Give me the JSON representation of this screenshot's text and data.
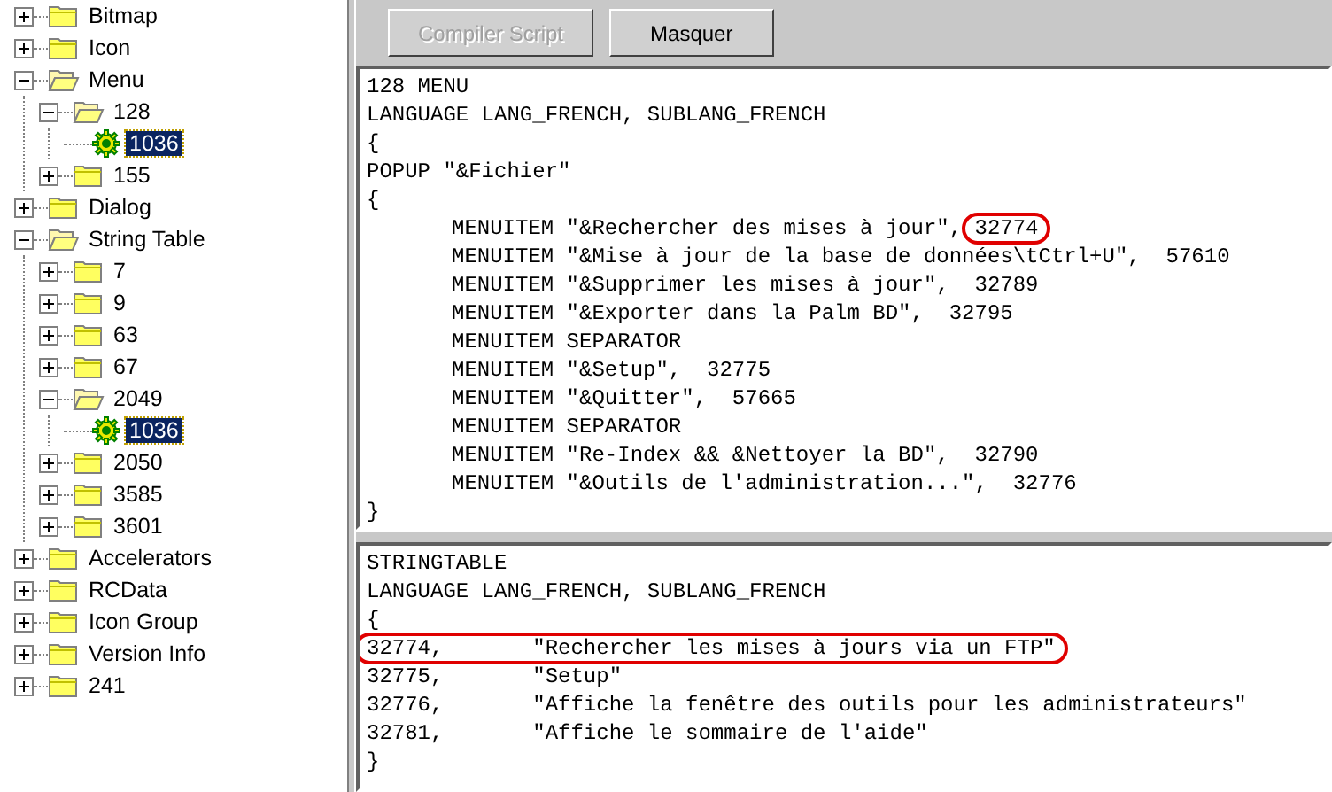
{
  "tree": [
    {
      "label": "Bitmap",
      "kind": "folder",
      "expanded": false,
      "selected": false
    },
    {
      "label": "Icon",
      "kind": "folder",
      "expanded": false,
      "selected": false
    },
    {
      "label": "Menu",
      "kind": "folder",
      "expanded": true,
      "selected": false,
      "children": [
        {
          "label": "128",
          "kind": "folder",
          "expanded": true,
          "selected": false,
          "children": [
            {
              "label": "1036",
              "kind": "resource",
              "selected": true
            }
          ]
        },
        {
          "label": "155",
          "kind": "folder",
          "expanded": false,
          "selected": false
        }
      ]
    },
    {
      "label": "Dialog",
      "kind": "folder",
      "expanded": false,
      "selected": false
    },
    {
      "label": "String Table",
      "kind": "folder",
      "expanded": true,
      "selected": false,
      "children": [
        {
          "label": "7",
          "kind": "folder",
          "expanded": false,
          "selected": false
        },
        {
          "label": "9",
          "kind": "folder",
          "expanded": false,
          "selected": false
        },
        {
          "label": "63",
          "kind": "folder",
          "expanded": false,
          "selected": false
        },
        {
          "label": "67",
          "kind": "folder",
          "expanded": false,
          "selected": false
        },
        {
          "label": "2049",
          "kind": "folder",
          "expanded": true,
          "selected": false,
          "children": [
            {
              "label": "1036",
              "kind": "resource",
              "selected": true
            }
          ]
        },
        {
          "label": "2050",
          "kind": "folder",
          "expanded": false,
          "selected": false
        },
        {
          "label": "3585",
          "kind": "folder",
          "expanded": false,
          "selected": false
        },
        {
          "label": "3601",
          "kind": "folder",
          "expanded": false,
          "selected": false
        }
      ]
    },
    {
      "label": "Accelerators",
      "kind": "folder",
      "expanded": false,
      "selected": false
    },
    {
      "label": "RCData",
      "kind": "folder",
      "expanded": false,
      "selected": false
    },
    {
      "label": "Icon Group",
      "kind": "folder",
      "expanded": false,
      "selected": false
    },
    {
      "label": "Version Info",
      "kind": "folder",
      "expanded": false,
      "selected": false
    },
    {
      "label": "241",
      "kind": "folder",
      "expanded": false,
      "selected": false
    }
  ],
  "toolbar": [
    {
      "label": "Compiler Script",
      "disabled": true
    },
    {
      "label": "Masquer",
      "disabled": false
    }
  ],
  "editors": [
    {
      "lines": [
        {
          "indented": false,
          "segments": [
            {
              "text": "128 MENU",
              "circled": false
            }
          ]
        },
        {
          "indented": false,
          "segments": [
            {
              "text": "LANGUAGE LANG_FRENCH, SUBLANG_FRENCH",
              "circled": false
            }
          ]
        },
        {
          "indented": false,
          "segments": [
            {
              "text": "{",
              "circled": false
            }
          ]
        },
        {
          "indented": false,
          "segments": [
            {
              "text": "POPUP \"&Fichier\"",
              "circled": false
            }
          ]
        },
        {
          "indented": false,
          "segments": [
            {
              "text": "{",
              "circled": false
            }
          ]
        },
        {
          "indented": true,
          "segments": [
            {
              "text": "MENUITEM \"&Rechercher des mises à jour\", ",
              "circled": false
            },
            {
              "text": "32774",
              "circled": true
            }
          ]
        },
        {
          "indented": true,
          "segments": [
            {
              "text": "MENUITEM \"&Mise à jour de la base de données\\tCtrl+U\",  57610",
              "circled": false
            }
          ]
        },
        {
          "indented": true,
          "segments": [
            {
              "text": "MENUITEM \"&Supprimer les mises à jour\",  32789",
              "circled": false
            }
          ]
        },
        {
          "indented": true,
          "segments": [
            {
              "text": "MENUITEM \"&Exporter dans la Palm BD\",  32795",
              "circled": false
            }
          ]
        },
        {
          "indented": true,
          "segments": [
            {
              "text": "MENUITEM SEPARATOR",
              "circled": false
            }
          ]
        },
        {
          "indented": true,
          "segments": [
            {
              "text": "MENUITEM \"&Setup\",  32775",
              "circled": false
            }
          ]
        },
        {
          "indented": true,
          "segments": [
            {
              "text": "MENUITEM \"&Quitter\",  57665",
              "circled": false
            }
          ]
        },
        {
          "indented": true,
          "segments": [
            {
              "text": "MENUITEM SEPARATOR",
              "circled": false
            }
          ]
        },
        {
          "indented": true,
          "segments": [
            {
              "text": "MENUITEM \"Re-Index && &Nettoyer la BD\",  32790",
              "circled": false
            }
          ]
        },
        {
          "indented": true,
          "segments": [
            {
              "text": "MENUITEM \"&Outils de l'administration...\",  32776",
              "circled": false
            }
          ]
        },
        {
          "indented": false,
          "segments": [
            {
              "text": "}",
              "circled": false
            }
          ]
        }
      ]
    },
    {
      "lines": [
        {
          "indented": false,
          "segments": [
            {
              "text": "STRINGTABLE",
              "circled": false
            }
          ]
        },
        {
          "indented": false,
          "segments": [
            {
              "text": "LANGUAGE LANG_FRENCH, SUBLANG_FRENCH",
              "circled": false
            }
          ]
        },
        {
          "indented": false,
          "segments": [
            {
              "text": "{",
              "circled": false
            }
          ]
        },
        {
          "indented": false,
          "segments": [
            {
              "text": "32774,       \"Rechercher les mises à jours via un FTP\"",
              "circled": true
            }
          ]
        },
        {
          "indented": false,
          "segments": [
            {
              "text": "32775,       \"Setup\"",
              "circled": false
            }
          ]
        },
        {
          "indented": false,
          "segments": [
            {
              "text": "32776,       \"Affiche la fenêtre des outils pour les administrateurs\"",
              "circled": false
            }
          ]
        },
        {
          "indented": false,
          "segments": [
            {
              "text": "32781,       \"Affiche le sommaire de l'aide\"",
              "circled": false
            }
          ]
        },
        {
          "indented": false,
          "segments": [
            {
              "text": "}",
              "circled": false
            }
          ]
        }
      ]
    }
  ]
}
